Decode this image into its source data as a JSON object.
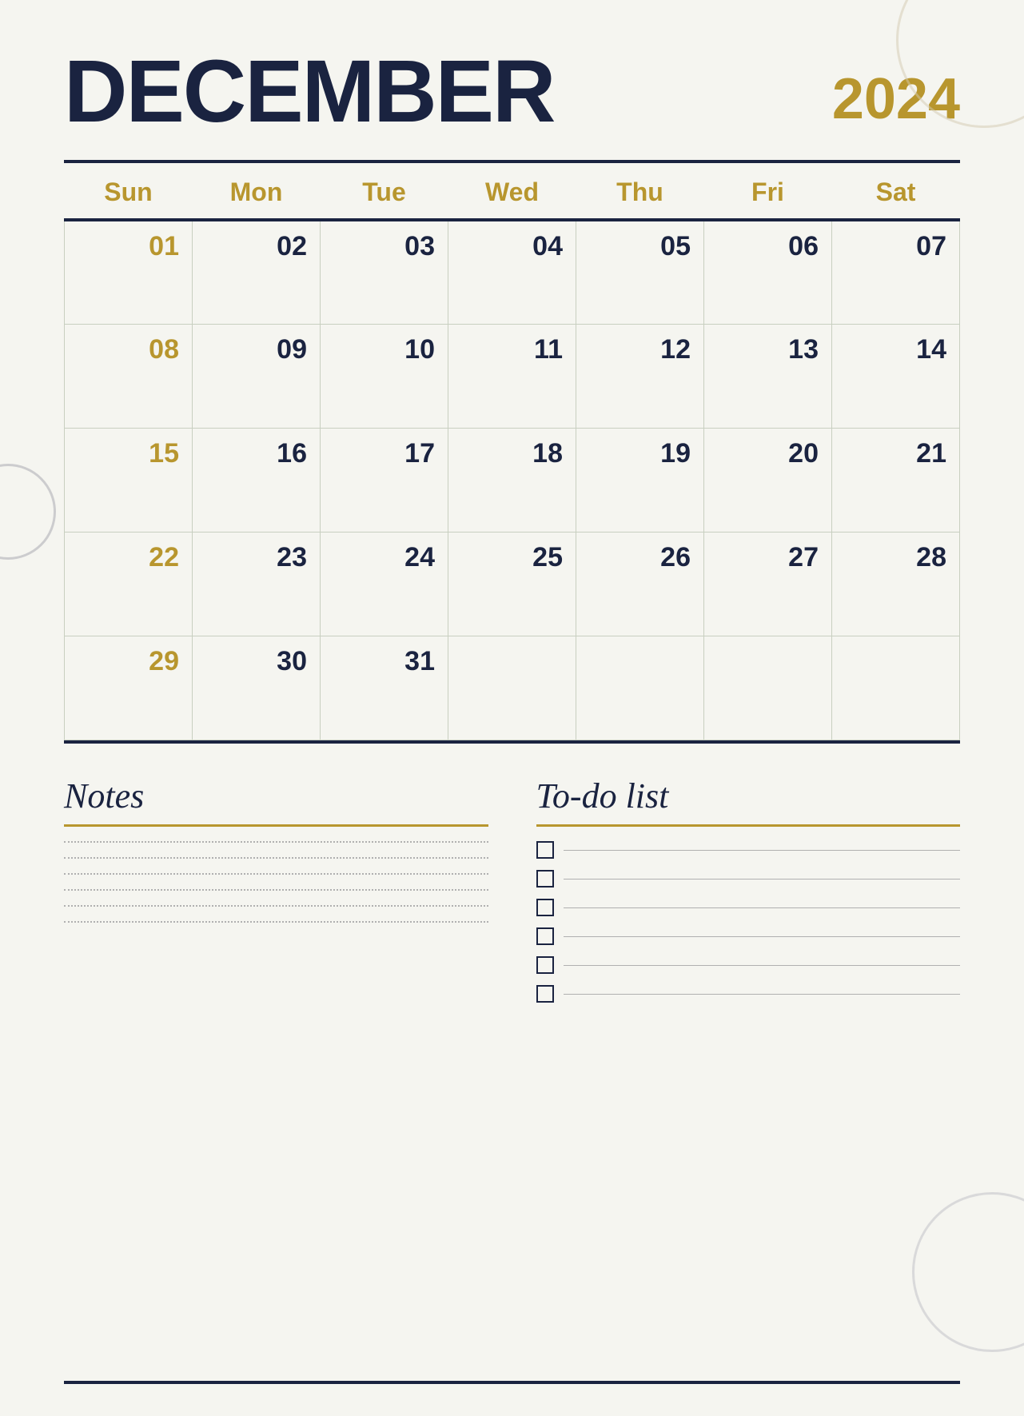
{
  "header": {
    "month": "DECEMBER",
    "year": "2024"
  },
  "calendar": {
    "days": [
      "Sun",
      "Mon",
      "Tue",
      "Wed",
      "Thu",
      "Fri",
      "Sat"
    ],
    "weeks": [
      [
        "01",
        "02",
        "03",
        "04",
        "05",
        "06",
        "07"
      ],
      [
        "08",
        "09",
        "10",
        "11",
        "12",
        "13",
        "14"
      ],
      [
        "15",
        "16",
        "17",
        "18",
        "19",
        "20",
        "21"
      ],
      [
        "22",
        "23",
        "24",
        "25",
        "26",
        "27",
        "28"
      ],
      [
        "29",
        "30",
        "31",
        "",
        "",
        "",
        ""
      ]
    ]
  },
  "notes": {
    "title": "Notes",
    "lines": 6
  },
  "todo": {
    "title": "To-do list",
    "items": 6
  },
  "colors": {
    "navy": "#1a2340",
    "gold": "#b8962e",
    "light_bg": "#f5f5f0"
  }
}
